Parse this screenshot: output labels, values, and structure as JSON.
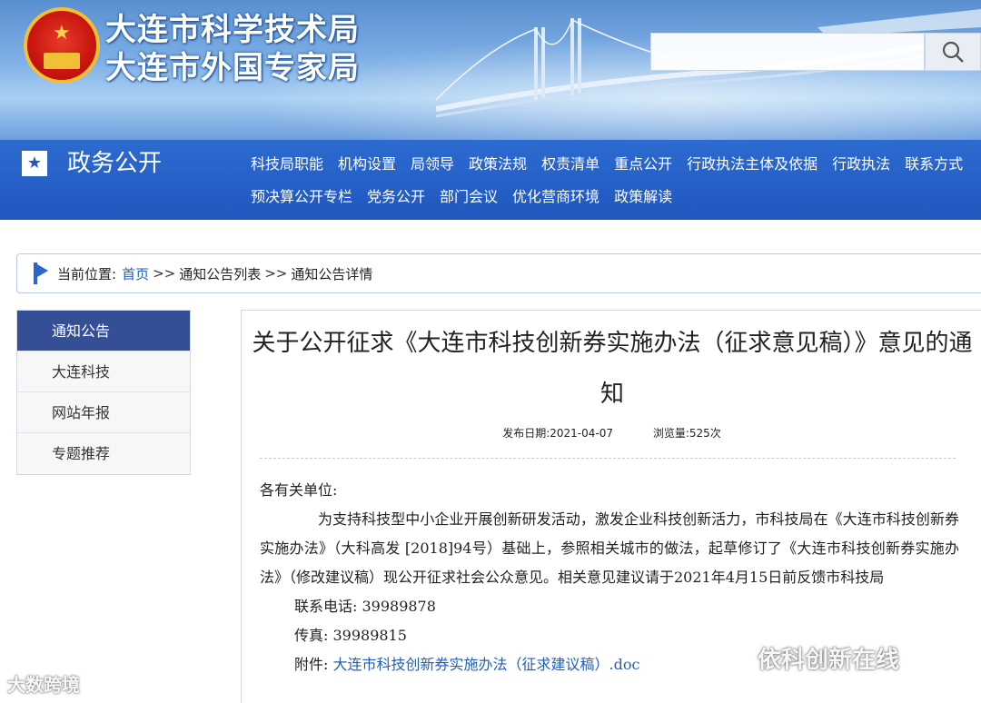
{
  "header": {
    "title_line1": "大连市科学技术局",
    "title_line2": "大连市外国专家局",
    "search": {
      "placeholder": "",
      "icon": "search-icon"
    }
  },
  "nav": {
    "section_title": "政务公开",
    "row1": [
      "科技局职能",
      "机构设置",
      "局领导",
      "政策法规",
      "权责清单",
      "重点公开",
      "行政执法主体及依据",
      "行政执法",
      "联系方式"
    ],
    "row2": [
      "预决算公开专栏",
      "党务公开",
      "部门会议",
      "优化营商环境",
      "政策解读"
    ]
  },
  "breadcrumb": {
    "label": "当前位置:",
    "home": "首页",
    "sep1": ">>",
    "list": "通知公告列表",
    "sep2": ">>",
    "current": "通知公告详情"
  },
  "sidebar": {
    "items": [
      {
        "label": "通知公告",
        "active": true
      },
      {
        "label": "大连科技",
        "active": false
      },
      {
        "label": "网站年报",
        "active": false
      },
      {
        "label": "专题推荐",
        "active": false
      }
    ]
  },
  "article": {
    "title": "关于公开征求《大连市科技创新券实施办法（征求意见稿）》意见的通知",
    "publish_date": "发布日期:2021-04-07",
    "views": "浏览量:525次",
    "salutation": "各有关单位:",
    "body": "为支持科技型中小企业开展创新研发活动，激发企业科技创新活力，市科技局在《大连市科技创新券实施办法》（大科高发 [2018]94号）基础上，参照相关城市的做法，起草修订了《大连市科技创新券实施办法》（修改建议稿）现公开征求社会公众意见。相关意见建议请于2021年4月15日前反馈市科技局",
    "phone": "联系电话: 39989878",
    "fax": "传真: 39989815",
    "attachment_label": "附件:",
    "attachment_name": "大连市科技创新券实施办法（征求建议稿）.doc"
  },
  "watermarks": {
    "left": "大数跨境",
    "right": "依科创新在线"
  }
}
